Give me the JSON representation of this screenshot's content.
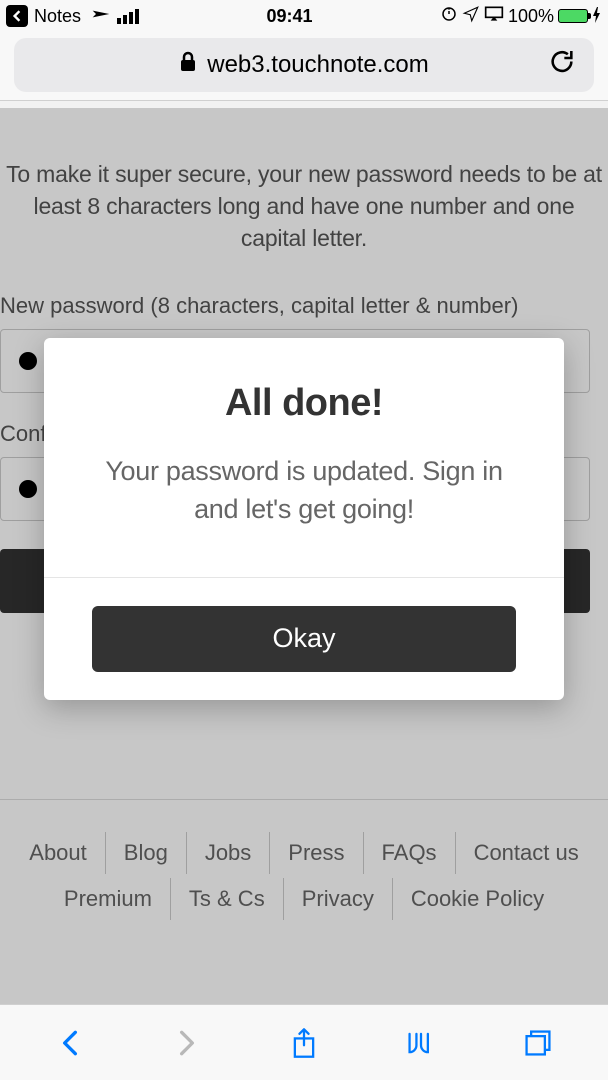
{
  "status_bar": {
    "back_app": "Notes",
    "time": "09:41",
    "battery_pct": "100%"
  },
  "url_bar": {
    "domain": "web3.touchnote.com"
  },
  "page": {
    "instructions": "To make it super secure, your new password needs to be at least 8 characters long and have one number and one capital letter.",
    "new_password_label": "New password (8 characters, capital letter & number)",
    "confirm_label": "Confirm new password"
  },
  "modal": {
    "title": "All done!",
    "body": "Your password is updated. Sign in and let's get going!",
    "button": "Okay"
  },
  "footer": {
    "row1": [
      "About",
      "Blog",
      "Jobs",
      "Press",
      "FAQs",
      "Contact us"
    ],
    "row2": [
      "Premium",
      "Ts & Cs",
      "Privacy",
      "Cookie Policy"
    ]
  }
}
